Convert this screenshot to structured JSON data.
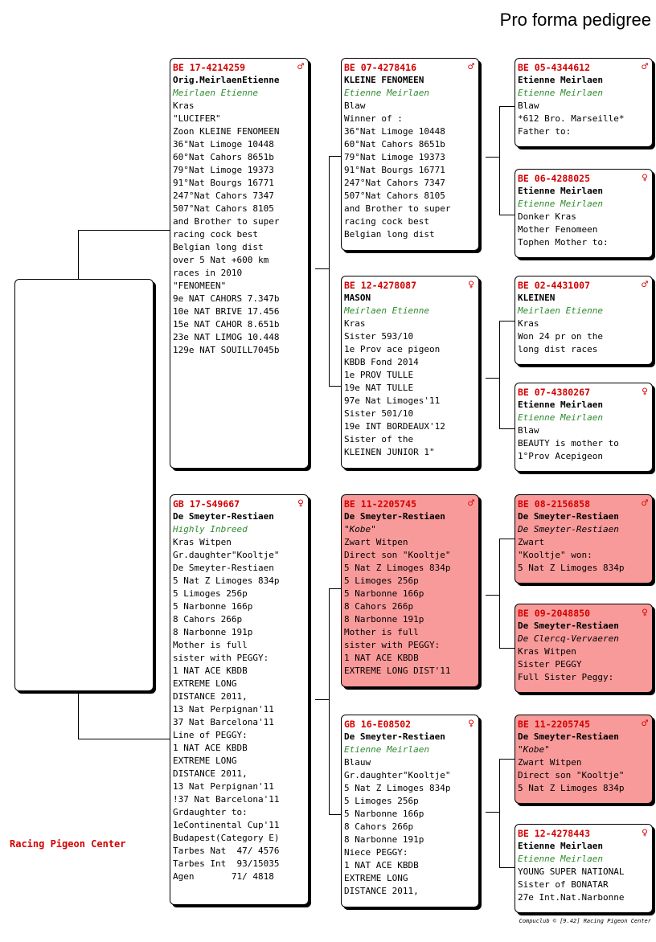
{
  "title": "Pro forma pedigree",
  "brand": "Racing Pigeon Center",
  "footer": "Compuclub © [9.42]  Racing Pigeon Center",
  "colors": {
    "ring": "#d40000",
    "breeder": "#2e8b2e",
    "pink": "#f99a9a"
  },
  "birds": {
    "sire": {
      "ring": "BE  17-4214259",
      "sex": "♂",
      "lines": [
        {
          "t": "Orig.MeirlaenEtienne",
          "c": "name"
        },
        {
          "t": "Meirlaen Etienne",
          "c": "breeder"
        },
        {
          "t": "Kras"
        },
        {
          "t": "\"LUCIFER\""
        },
        {
          "t": "Zoon KLEINE FENOMEEN"
        },
        {
          "t": "36°Nat Limoge 10448"
        },
        {
          "t": "60°Nat Cahors 8651b"
        },
        {
          "t": "79°Nat Limoge 19373"
        },
        {
          "t": "91°Nat Bourgs 16771"
        },
        {
          "t": "247°Nat Cahors 7347"
        },
        {
          "t": "507°Nat Cahors 8105"
        },
        {
          "t": "and Brother to super"
        },
        {
          "t": "racing cock best"
        },
        {
          "t": "Belgian long dist"
        },
        {
          "t": "over 5 Nat +600 km"
        },
        {
          "t": "races in 2010"
        },
        {
          "t": "\"FENOMEEN\""
        },
        {
          "t": "9e NAT CAHORS 7.347b"
        },
        {
          "t": "10e NAT BRIVE 17.456"
        },
        {
          "t": "15e NAT CAHOR 8.651b"
        },
        {
          "t": "23e NAT LIMOG 10.448"
        },
        {
          "t": "129e NAT SOUILL7045b"
        }
      ]
    },
    "dam": {
      "ring": "GB  17-S49667",
      "sex": "♀",
      "lines": [
        {
          "t": "De Smeyter-Restiaen",
          "c": "name"
        },
        {
          "t": "Highly Inbreed",
          "c": "breeder"
        },
        {
          "t": "Kras Witpen"
        },
        {
          "t": "Gr.daughter\"Kooltje\""
        },
        {
          "t": "De Smeyter-Restiaen"
        },
        {
          "t": "5 Nat Z Limoges 834p"
        },
        {
          "t": "5 Limoges 256p"
        },
        {
          "t": "5 Narbonne 166p"
        },
        {
          "t": "8 Cahors 266p"
        },
        {
          "t": "8 Narbonne 191p"
        },
        {
          "t": "Mother is full"
        },
        {
          "t": "sister with PEGGY:"
        },
        {
          "t": "1 NAT ACE KBDB"
        },
        {
          "t": "EXTREME LONG"
        },
        {
          "t": "DISTANCE 2011,"
        },
        {
          "t": "13 Nat Perpignan'11"
        },
        {
          "t": "37 Nat Barcelona'11"
        },
        {
          "t": "Line of PEGGY:"
        },
        {
          "t": "1 NAT ACE KBDB"
        },
        {
          "t": "EXTREME LONG"
        },
        {
          "t": "DISTANCE 2011,"
        },
        {
          "t": "13 Nat Perpignan'11"
        },
        {
          "t": "!37 Nat Barcelona'11"
        },
        {
          "t": "Grdaughter to:"
        },
        {
          "t": "1eContinental Cup'11"
        },
        {
          "t": "Budapest(Category E)"
        },
        {
          "t": "Tarbes Nat  47/ 4576"
        },
        {
          "t": "Tarbes Int  93/15035"
        },
        {
          "t": "Agen       71/ 4818"
        }
      ]
    },
    "ss": {
      "ring": "BE  07-4278416",
      "sex": "♂",
      "lines": [
        {
          "t": "KLEINE FENOMEEN",
          "c": "name"
        },
        {
          "t": "Etienne Meirlaen",
          "c": "breeder"
        },
        {
          "t": "Blaw"
        },
        {
          "t": "Winner of :"
        },
        {
          "t": "36°Nat Limoge 10448"
        },
        {
          "t": "60°Nat Cahors 8651b"
        },
        {
          "t": "79°Nat Limoge 19373"
        },
        {
          "t": "91°Nat Bourgs 16771"
        },
        {
          "t": "247°Nat Cahors 7347"
        },
        {
          "t": "507°Nat Cahors 8105"
        },
        {
          "t": "and Brother to super"
        },
        {
          "t": "racing cock best"
        },
        {
          "t": "Belgian long dist"
        }
      ]
    },
    "sd": {
      "ring": "BE  12-4278087",
      "sex": "♀",
      "lines": [
        {
          "t": "MASON",
          "c": "name"
        },
        {
          "t": "Meirlaen Etienne",
          "c": "breeder"
        },
        {
          "t": "Kras"
        },
        {
          "t": "Sister 593/10"
        },
        {
          "t": "1e Prov ace pigeon"
        },
        {
          "t": "KBDB Fond 2014"
        },
        {
          "t": "1e PROV TULLE"
        },
        {
          "t": "19e NAT TULLE"
        },
        {
          "t": "97e Nat Limoges'11"
        },
        {
          "t": "Sister 501/10"
        },
        {
          "t": "19e INT BORDEAUX'12"
        },
        {
          "t": "Sister of the"
        },
        {
          "t": "KLEINEN JUNIOR 1\""
        }
      ]
    },
    "ds": {
      "ring": "BE  11-2205745",
      "sex": "♂",
      "lines": [
        {
          "t": "De Smeyter-Restiaen",
          "c": "name"
        },
        {
          "t": "\"Kobe\"",
          "c": "breeder dark"
        },
        {
          "t": "Zwart Witpen"
        },
        {
          "t": "Direct son \"Kooltje\""
        },
        {
          "t": "5 Nat Z Limoges 834p"
        },
        {
          "t": "5 Limoges 256p"
        },
        {
          "t": "5 Narbonne 166p"
        },
        {
          "t": "8 Cahors 266p"
        },
        {
          "t": "8 Narbonne 191p"
        },
        {
          "t": "Mother is full"
        },
        {
          "t": "sister with PEGGY:"
        },
        {
          "t": "1 NAT ACE KBDB"
        },
        {
          "t": "EXTREME LONG DIST'11"
        }
      ]
    },
    "dd": {
      "ring": "GB  16-E08502",
      "sex": "♀",
      "lines": [
        {
          "t": "De Smeyter-Restiaen",
          "c": "name"
        },
        {
          "t": "Etienne Meirlaen",
          "c": "breeder"
        },
        {
          "t": "Blauw"
        },
        {
          "t": "Gr.daughter\"Kooltje\""
        },
        {
          "t": "5 Nat Z Limoges 834p"
        },
        {
          "t": "5 Limoges 256p"
        },
        {
          "t": "5 Narbonne 166p"
        },
        {
          "t": "8 Cahors 266p"
        },
        {
          "t": "8 Narbonne 191p"
        },
        {
          "t": "Niece PEGGY:"
        },
        {
          "t": "1 NAT ACE KBDB"
        },
        {
          "t": "EXTREME LONG"
        },
        {
          "t": "DISTANCE 2011,"
        }
      ]
    },
    "sss": {
      "ring": "BE  05-4344612",
      "sex": "♂",
      "lines": [
        {
          "t": "Etienne Meirlaen",
          "c": "name"
        },
        {
          "t": "Etienne Meirlaen",
          "c": "breeder"
        },
        {
          "t": "Blaw"
        },
        {
          "t": "*612 Bro. Marseille*"
        },
        {
          "t": "Father to:"
        }
      ]
    },
    "ssd": {
      "ring": "BE  06-4288025",
      "sex": "♀",
      "lines": [
        {
          "t": "Etienne Meirlaen",
          "c": "name"
        },
        {
          "t": "Etienne Meirlaen",
          "c": "breeder"
        },
        {
          "t": "Donker Kras"
        },
        {
          "t": "Mother Fenomeen"
        },
        {
          "t": "Tophen Mother to:"
        }
      ]
    },
    "sds": {
      "ring": "BE  02-4431007",
      "sex": "♂",
      "lines": [
        {
          "t": "KLEINEN",
          "c": "name"
        },
        {
          "t": "Meirlaen Etienne",
          "c": "breeder"
        },
        {
          "t": "Kras"
        },
        {
          "t": "Won 24 pr on the"
        },
        {
          "t": "long dist races"
        }
      ]
    },
    "sdd": {
      "ring": "BE  07-4380267",
      "sex": "♀",
      "lines": [
        {
          "t": "Etienne Meirlaen",
          "c": "name"
        },
        {
          "t": "Etienne Meirlaen",
          "c": "breeder"
        },
        {
          "t": "Blaw"
        },
        {
          "t": "BEAUTY is mother to"
        },
        {
          "t": "1°Prov Acepigeon"
        }
      ]
    },
    "dss": {
      "ring": "BE  08-2156858",
      "sex": "♂",
      "lines": [
        {
          "t": "De Smeyter-Restiaen",
          "c": "name"
        },
        {
          "t": "De Smeyter-Restiaen",
          "c": "breeder dark"
        },
        {
          "t": "Zwart"
        },
        {
          "t": "\"Kooltje\" won:"
        },
        {
          "t": "5 Nat Z Limoges 834p"
        }
      ]
    },
    "dsd": {
      "ring": "BE  09-2048850",
      "sex": "♀",
      "lines": [
        {
          "t": "De Smeyter-Restiaen",
          "c": "name"
        },
        {
          "t": "De Clercq-Vervaeren",
          "c": "breeder dark"
        },
        {
          "t": "Kras Witpen"
        },
        {
          "t": "Sister PEGGY"
        },
        {
          "t": "Full Sister Peggy:"
        }
      ]
    },
    "dds": {
      "ring": "BE  11-2205745",
      "sex": "♂",
      "lines": [
        {
          "t": "De Smeyter-Restiaen",
          "c": "name"
        },
        {
          "t": "\"Kobe\"",
          "c": "breeder dark"
        },
        {
          "t": "Zwart Witpen"
        },
        {
          "t": "Direct son \"Kooltje\""
        },
        {
          "t": "5 Nat Z Limoges 834p"
        }
      ]
    },
    "ddd": {
      "ring": "BE  12-4278443",
      "sex": "♀",
      "lines": [
        {
          "t": "Etienne Meirlaen",
          "c": "name"
        },
        {
          "t": "Etienne Meirlaen",
          "c": "breeder"
        },
        {
          "t": "YOUNG SUPER NATIONAL"
        },
        {
          "t": "Sister of BONATAR"
        },
        {
          "t": "27e Int.Nat.Narbonne"
        }
      ]
    }
  }
}
